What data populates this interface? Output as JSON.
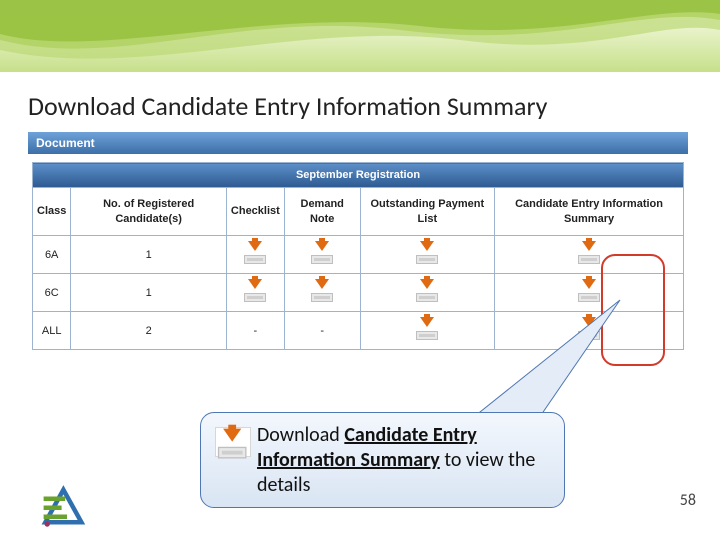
{
  "title": "Download Candidate Entry Information Summary",
  "tab": "Document",
  "table": {
    "septHeader": "September Registration",
    "cols": {
      "class": "Class",
      "reg": "No. of Registered Candidate(s)",
      "checklist": "Checklist",
      "demand": "Demand Note",
      "outstanding": "Outstanding Payment List",
      "candEntry": "Candidate Entry Information Summary"
    },
    "rows": [
      {
        "class": "6A",
        "reg": "1",
        "checklist": "dl",
        "demand": "dl",
        "outstanding": "dl",
        "cand": "dl"
      },
      {
        "class": "6C",
        "reg": "1",
        "checklist": "dl",
        "demand": "dl",
        "outstanding": "dl",
        "cand": "dl"
      },
      {
        "class": "ALL",
        "reg": "2",
        "checklist": "-",
        "demand": "-",
        "outstanding": "dl",
        "cand": "dl"
      }
    ]
  },
  "callout": {
    "prefix": "Download ",
    "bold": "Candidate Entry Information Summary",
    "suffix": " to view the details"
  },
  "pageNumber": "58"
}
